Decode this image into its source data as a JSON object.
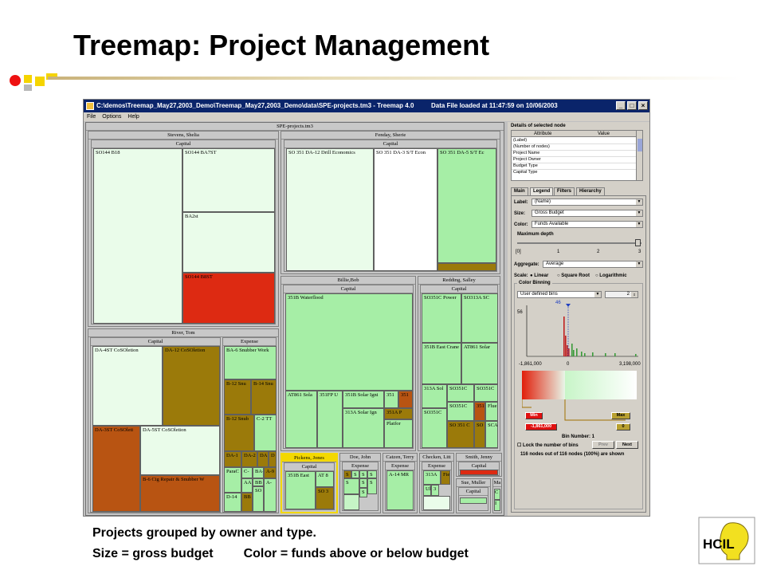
{
  "slide": {
    "title": "Treemap: Project Management",
    "caption_line1": "Projects grouped by owner and type.",
    "caption_size": "Size = gross budget",
    "caption_color": "Color = funds above or below budget",
    "logo_text": "HCIL"
  },
  "window": {
    "title": "C:\\demos\\Treemap_May27,2003_Demo\\Treemap_May27,2003_Demo\\data\\SPE-projects.tm3 - Treemap 4.0",
    "loaded_status": "Data File loaded at 11:47:59 on 10/06/2003",
    "menu": [
      "File",
      "Options",
      "Help"
    ]
  },
  "treemap": {
    "root_label": "SPE-projects.tm3",
    "groups": {
      "stevens": {
        "owner": "Stevens, Shelia",
        "capital": "Capital",
        "cells": [
          "SO144 B18",
          "SO144 BA7ST",
          "BA2st",
          "SO144 B8ST"
        ]
      },
      "fenday": {
        "owner": "Fenday, Sherie",
        "capital": "Capital",
        "cells": [
          "SO 351 DA-12 Drill Economics",
          "SO 351 DA-3 S/T Econ",
          "SO 351 DA-5 S/T Ec"
        ]
      },
      "river": {
        "owner": "River, Tom",
        "capital": "Capital",
        "expense": "Expense",
        "capital_cells": [
          "DA-4ST CoSOletion",
          "DA-12 CoSOletion",
          "DA-3ST CoSOleti",
          "DA-5ST CoSOletion",
          "B-6 Cig Repair & Snubber W"
        ],
        "expense_cells": [
          "BA-6 Snubber Work",
          "B-12 Snu",
          "B-14 Snu",
          "B-12 Snub",
          "C-2 TT",
          "DA-1",
          "DA-2",
          "DA",
          "D",
          "C-",
          "BA-",
          "A-9",
          "ParaC",
          "AA",
          "BB",
          "D-14",
          "BB",
          "SO",
          "A-"
        ]
      },
      "billie": {
        "owner": "Billie,Bob",
        "capital": "Capital",
        "cells": [
          "351B Waterflood",
          "AT861 Sola",
          "351FP U",
          "351B Solar Igni",
          "351",
          "351",
          "313A Solar Ign",
          "351A P",
          "Platfor"
        ]
      },
      "redding": {
        "owner": "Redding, Salley",
        "capital": "Capital",
        "cells": [
          "SO351C Power",
          "SO313A SC",
          "351B East Crane",
          "AT861 Solar",
          "313A Sol",
          "SO351C",
          "SO351C",
          "SO351C",
          "SO351C",
          "351",
          "Flue",
          "SO 351 C",
          "SO",
          "SCA"
        ]
      },
      "pickens": {
        "owner": "Pickens, Jones",
        "capital": "Capital",
        "cells": [
          "351B East",
          "AT 8",
          "SO 3"
        ]
      },
      "doe": {
        "owner": "Doe, John",
        "expense": "Expense",
        "cells": [
          "S",
          "S",
          "S",
          "S",
          "S",
          "S",
          "S",
          "S"
        ]
      },
      "catzen": {
        "owner": "Catzen, Terry",
        "expense": "Expense",
        "cells": [
          "A-14 MR"
        ]
      },
      "checken": {
        "owner": "Checken, Litt",
        "expense": "Expense",
        "cells": [
          "313A",
          "Fiel",
          "Ul",
          "3"
        ]
      },
      "smith": {
        "owner": "Smith, Jenny",
        "capital": "Capital"
      },
      "sue": {
        "owner": "Sue, Muller",
        "capital": "Capital"
      },
      "ma": {
        "owner": "Ma",
        "cells": [
          "C",
          "I"
        ]
      }
    }
  },
  "details": {
    "heading": "Details of selected node",
    "col_attribute": "Attribute",
    "col_value": "Value",
    "rows": [
      "(Label)",
      "(Number of nodes)",
      "Project Name",
      "Project Owner",
      "Budget Type",
      "Capital Type"
    ]
  },
  "tabs": [
    "Main",
    "Legend",
    "Filters",
    "Hierarchy"
  ],
  "controls": {
    "label_label": "Label:",
    "label_value": "(Name)",
    "size_label": "Size:",
    "size_value": "Gross Budget",
    "color_label": "Color:",
    "color_value": "Funds Available",
    "max_depth_label": "Maximum depth",
    "depth_ticks": [
      "[0]",
      "1",
      "2",
      "3"
    ],
    "aggregate_label": "Aggregate:",
    "aggregate_value": "Average",
    "scale_label": "Scale:",
    "scale_options": [
      "Linear",
      "Square Root",
      "Logarithmic"
    ],
    "scale_selected": "Linear",
    "color_binning_label": "Color Binning",
    "bins_value": "User defined bins",
    "bins_spinner": "2",
    "hist_max": "56",
    "hist_marker": "46",
    "axis_min": "-1,861,000",
    "axis_zero": "0",
    "axis_max": "3,198,000",
    "min_button": "Min",
    "min_value": "-1,861,000",
    "max_button": "Max",
    "max_value": "0",
    "bin_number_label": "Bin Number: 1",
    "lock_label": "Lock the number of bins",
    "prev_button": "Prev",
    "next_button": "Next",
    "status": "116 nodes out of 116 nodes (100%) are shown"
  },
  "colors": {
    "accent_red": "#dd2a12",
    "accent_green": "#a6eea6",
    "title_bar": "#0a246a"
  }
}
